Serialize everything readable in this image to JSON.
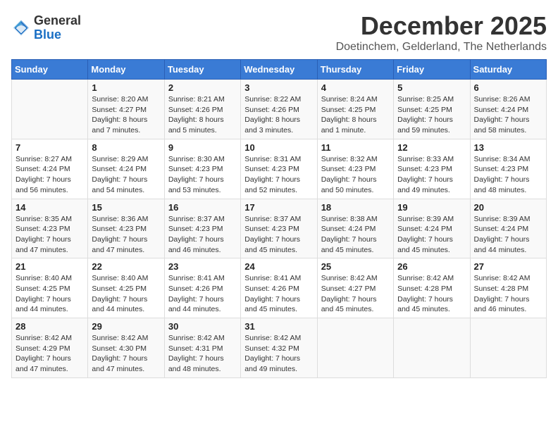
{
  "logo": {
    "general": "General",
    "blue": "Blue"
  },
  "title": "December 2025",
  "subtitle": "Doetinchem, Gelderland, The Netherlands",
  "days": [
    "Sunday",
    "Monday",
    "Tuesday",
    "Wednesday",
    "Thursday",
    "Friday",
    "Saturday"
  ],
  "weeks": [
    [
      {
        "day": "",
        "content": ""
      },
      {
        "day": "1",
        "content": "Sunrise: 8:20 AM\nSunset: 4:27 PM\nDaylight: 8 hours\nand 7 minutes."
      },
      {
        "day": "2",
        "content": "Sunrise: 8:21 AM\nSunset: 4:26 PM\nDaylight: 8 hours\nand 5 minutes."
      },
      {
        "day": "3",
        "content": "Sunrise: 8:22 AM\nSunset: 4:26 PM\nDaylight: 8 hours\nand 3 minutes."
      },
      {
        "day": "4",
        "content": "Sunrise: 8:24 AM\nSunset: 4:25 PM\nDaylight: 8 hours\nand 1 minute."
      },
      {
        "day": "5",
        "content": "Sunrise: 8:25 AM\nSunset: 4:25 PM\nDaylight: 7 hours\nand 59 minutes."
      },
      {
        "day": "6",
        "content": "Sunrise: 8:26 AM\nSunset: 4:24 PM\nDaylight: 7 hours\nand 58 minutes."
      }
    ],
    [
      {
        "day": "7",
        "content": "Sunrise: 8:27 AM\nSunset: 4:24 PM\nDaylight: 7 hours\nand 56 minutes."
      },
      {
        "day": "8",
        "content": "Sunrise: 8:29 AM\nSunset: 4:24 PM\nDaylight: 7 hours\nand 54 minutes."
      },
      {
        "day": "9",
        "content": "Sunrise: 8:30 AM\nSunset: 4:23 PM\nDaylight: 7 hours\nand 53 minutes."
      },
      {
        "day": "10",
        "content": "Sunrise: 8:31 AM\nSunset: 4:23 PM\nDaylight: 7 hours\nand 52 minutes."
      },
      {
        "day": "11",
        "content": "Sunrise: 8:32 AM\nSunset: 4:23 PM\nDaylight: 7 hours\nand 50 minutes."
      },
      {
        "day": "12",
        "content": "Sunrise: 8:33 AM\nSunset: 4:23 PM\nDaylight: 7 hours\nand 49 minutes."
      },
      {
        "day": "13",
        "content": "Sunrise: 8:34 AM\nSunset: 4:23 PM\nDaylight: 7 hours\nand 48 minutes."
      }
    ],
    [
      {
        "day": "14",
        "content": "Sunrise: 8:35 AM\nSunset: 4:23 PM\nDaylight: 7 hours\nand 47 minutes."
      },
      {
        "day": "15",
        "content": "Sunrise: 8:36 AM\nSunset: 4:23 PM\nDaylight: 7 hours\nand 47 minutes."
      },
      {
        "day": "16",
        "content": "Sunrise: 8:37 AM\nSunset: 4:23 PM\nDaylight: 7 hours\nand 46 minutes."
      },
      {
        "day": "17",
        "content": "Sunrise: 8:37 AM\nSunset: 4:23 PM\nDaylight: 7 hours\nand 45 minutes."
      },
      {
        "day": "18",
        "content": "Sunrise: 8:38 AM\nSunset: 4:24 PM\nDaylight: 7 hours\nand 45 minutes."
      },
      {
        "day": "19",
        "content": "Sunrise: 8:39 AM\nSunset: 4:24 PM\nDaylight: 7 hours\nand 45 minutes."
      },
      {
        "day": "20",
        "content": "Sunrise: 8:39 AM\nSunset: 4:24 PM\nDaylight: 7 hours\nand 44 minutes."
      }
    ],
    [
      {
        "day": "21",
        "content": "Sunrise: 8:40 AM\nSunset: 4:25 PM\nDaylight: 7 hours\nand 44 minutes."
      },
      {
        "day": "22",
        "content": "Sunrise: 8:40 AM\nSunset: 4:25 PM\nDaylight: 7 hours\nand 44 minutes."
      },
      {
        "day": "23",
        "content": "Sunrise: 8:41 AM\nSunset: 4:26 PM\nDaylight: 7 hours\nand 44 minutes."
      },
      {
        "day": "24",
        "content": "Sunrise: 8:41 AM\nSunset: 4:26 PM\nDaylight: 7 hours\nand 45 minutes."
      },
      {
        "day": "25",
        "content": "Sunrise: 8:42 AM\nSunset: 4:27 PM\nDaylight: 7 hours\nand 45 minutes."
      },
      {
        "day": "26",
        "content": "Sunrise: 8:42 AM\nSunset: 4:28 PM\nDaylight: 7 hours\nand 45 minutes."
      },
      {
        "day": "27",
        "content": "Sunrise: 8:42 AM\nSunset: 4:28 PM\nDaylight: 7 hours\nand 46 minutes."
      }
    ],
    [
      {
        "day": "28",
        "content": "Sunrise: 8:42 AM\nSunset: 4:29 PM\nDaylight: 7 hours\nand 47 minutes."
      },
      {
        "day": "29",
        "content": "Sunrise: 8:42 AM\nSunset: 4:30 PM\nDaylight: 7 hours\nand 47 minutes."
      },
      {
        "day": "30",
        "content": "Sunrise: 8:42 AM\nSunset: 4:31 PM\nDaylight: 7 hours\nand 48 minutes."
      },
      {
        "day": "31",
        "content": "Sunrise: 8:42 AM\nSunset: 4:32 PM\nDaylight: 7 hours\nand 49 minutes."
      },
      {
        "day": "",
        "content": ""
      },
      {
        "day": "",
        "content": ""
      },
      {
        "day": "",
        "content": ""
      }
    ]
  ]
}
